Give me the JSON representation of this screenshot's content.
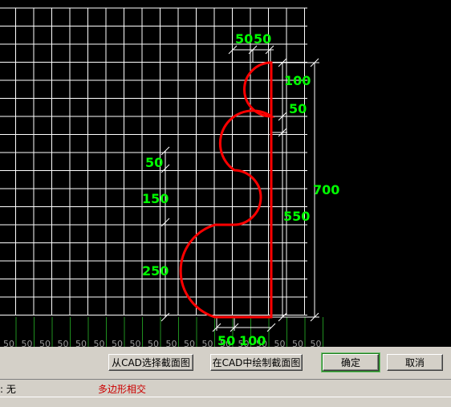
{
  "dimensions": {
    "top_left": "50",
    "top_right": "50",
    "right_upper": "100",
    "right_second": "50",
    "right_lower": "550",
    "overall": "700",
    "left_upper": "50",
    "left_middle": "150",
    "left_lower": "250",
    "bottom_left": "50",
    "bottom_right": "100"
  },
  "ruler": {
    "tick_labels": [
      "50",
      "50",
      "50",
      "50",
      "50",
      "50",
      "50",
      "50",
      "50",
      "50",
      "50",
      "50",
      "50",
      "50",
      "50",
      "50",
      "50",
      "50"
    ]
  },
  "buttons": {
    "select_from_cad": "从CAD选择截面图",
    "draw_in_cad": "在CAD中绘制截面图",
    "ok": "确定",
    "cancel": "取消"
  },
  "status": {
    "left_text": ": 无",
    "error_text": "多边形相交"
  },
  "colors": {
    "background": "#000000",
    "grid": "#ffffff",
    "outline": "#ff0000",
    "dimension_text": "#00ff00",
    "error_text": "#cc0000"
  }
}
